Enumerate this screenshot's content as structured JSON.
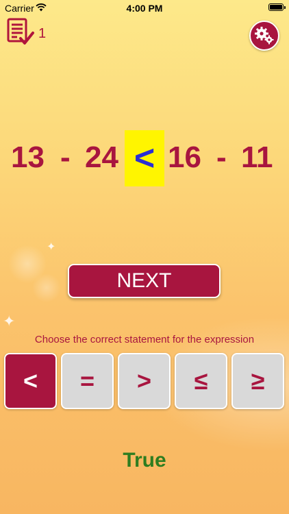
{
  "status_bar": {
    "carrier": "Carrier",
    "time": "4:00 PM",
    "wifi_icon": "wifi-icon",
    "battery_icon": "battery-icon"
  },
  "header": {
    "task_icon": "checklist-icon",
    "task_count": "1",
    "settings_icon": "gears-icon"
  },
  "expression": {
    "left_a": "13",
    "left_op": "-",
    "left_b": "24",
    "comparison": "<",
    "right_a": "16",
    "right_op": "-",
    "right_b": "11"
  },
  "next_button": {
    "label": "NEXT"
  },
  "instruction": "Choose the correct statement for the expression",
  "choices": [
    {
      "label": "<",
      "selected": true
    },
    {
      "label": "=",
      "selected": false
    },
    {
      "label": ">",
      "selected": false
    },
    {
      "label": "≤",
      "selected": false
    },
    {
      "label": "≥",
      "selected": false
    }
  ],
  "result": "True",
  "colors": {
    "accent": "#a8153f",
    "highlight": "#fff500",
    "operator_highlight_text": "#2a2fd4",
    "result": "#2e7d20",
    "button_gray": "#d9d9d9"
  }
}
